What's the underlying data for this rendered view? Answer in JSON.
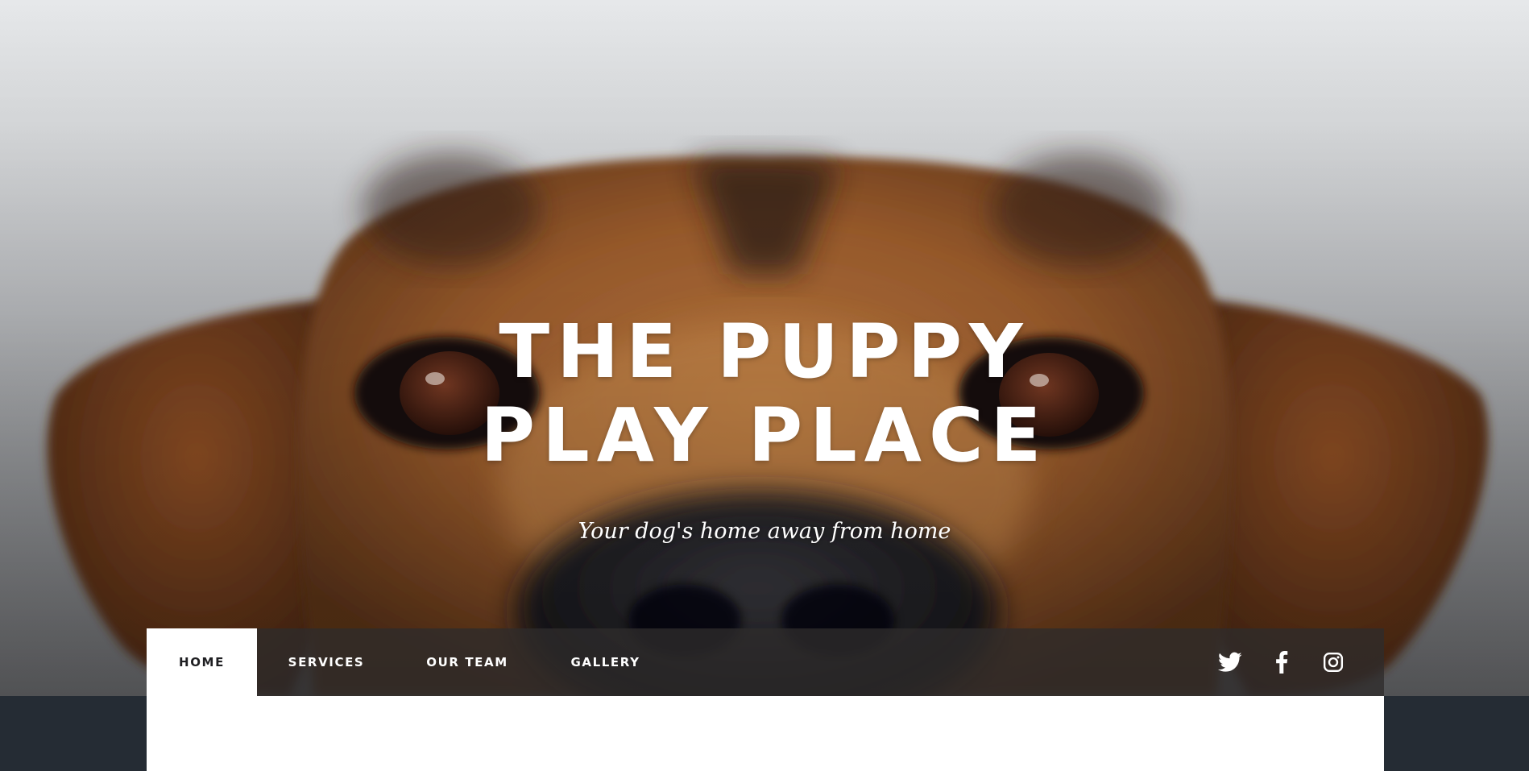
{
  "hero": {
    "title_line1": "THE PUPPY",
    "title_line2": "PLAY PLACE",
    "tagline": "Your dog's home away from home"
  },
  "nav": {
    "items": [
      {
        "label": "HOME",
        "active": true
      },
      {
        "label": "SERVICES",
        "active": false
      },
      {
        "label": "OUR TEAM",
        "active": false
      },
      {
        "label": "GALLERY",
        "active": false
      }
    ],
    "social": [
      "twitter-icon",
      "facebook-icon",
      "instagram-icon"
    ]
  },
  "colors": {
    "nav_background": "#2e2c2c",
    "active_tab_background": "#ffffff",
    "page_background": "#252c34",
    "text_light": "#ffffff",
    "text_dark": "#1f1f22"
  }
}
